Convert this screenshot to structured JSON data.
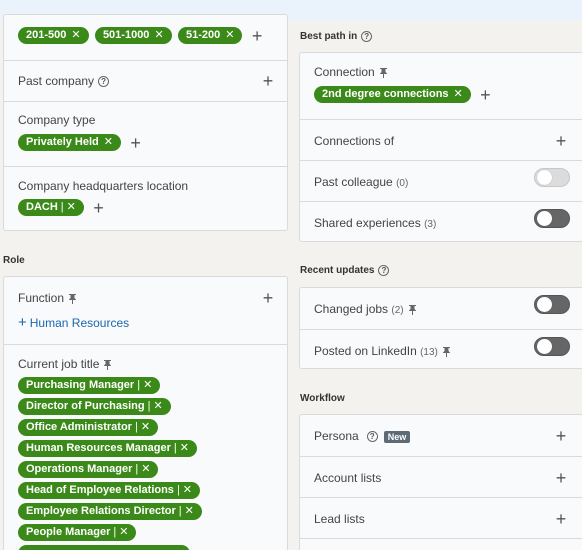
{
  "left": {
    "headcount_pills": [
      "201-500",
      "501-1000",
      "51-200"
    ],
    "past_company": {
      "label": "Past company"
    },
    "company_type": {
      "label": "Company type",
      "pills": [
        "Privately Held"
      ]
    },
    "hq_location": {
      "label": "Company headquarters location",
      "pills": [
        "DACH"
      ]
    },
    "role_section": {
      "title": "Role"
    },
    "function": {
      "label": "Function",
      "add_label": "Human Resources"
    },
    "current_job_title": {
      "label": "Current job title",
      "pills": [
        "Purchasing Manager",
        "Director of Purchasing",
        "Office Administrator",
        "Human Resources Manager",
        "Operations Manager",
        "Head of Employee Relations",
        "Employee Relations Director",
        "People Manager"
      ]
    }
  },
  "right": {
    "best_path": {
      "title": "Best path in"
    },
    "connection": {
      "label": "Connection",
      "pill": "2nd degree connections"
    },
    "connections_of": {
      "label": "Connections of"
    },
    "past_colleague": {
      "label": "Past colleague",
      "count": "(0)"
    },
    "shared_experiences": {
      "label": "Shared experiences",
      "count": "(3)"
    },
    "recent_updates": {
      "title": "Recent updates"
    },
    "changed_jobs": {
      "label": "Changed jobs",
      "count": "(2)"
    },
    "posted_on_linkedin": {
      "label": "Posted on LinkedIn",
      "count": "(13)"
    },
    "workflow": {
      "title": "Workflow"
    },
    "persona": {
      "label": "Persona",
      "badge": "New"
    },
    "account_lists": {
      "label": "Account lists"
    },
    "lead_lists": {
      "label": "Lead lists"
    }
  },
  "colors": {
    "pill_green": "#3b8a19",
    "link_blue": "#1a66b0",
    "toggle_off": "#dcdcdc",
    "toggle_dark": "#666666"
  }
}
